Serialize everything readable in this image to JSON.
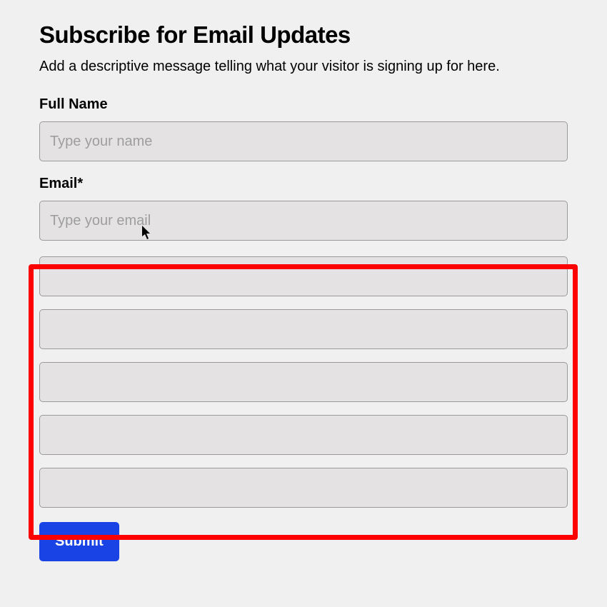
{
  "heading": "Subscribe for Email Updates",
  "description": "Add a descriptive message telling what your visitor is signing up for here.",
  "fields": {
    "fullName": {
      "label": "Full Name",
      "placeholder": "Type your name",
      "value": ""
    },
    "email": {
      "label": "Email*",
      "placeholder": "Type your email",
      "value": ""
    }
  },
  "extraFieldCount": 5,
  "submitLabel": "Submit"
}
